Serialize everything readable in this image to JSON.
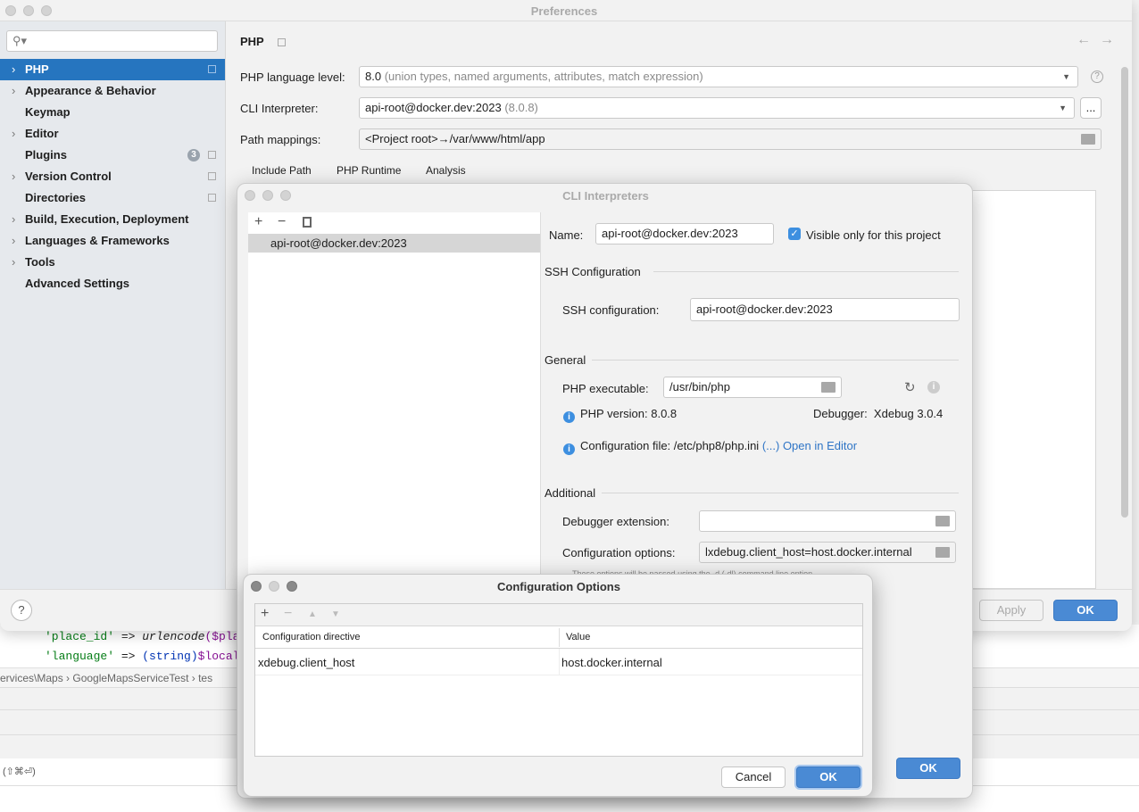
{
  "prefs": {
    "title": "Preferences",
    "search_placeholder": "",
    "sidebar": [
      {
        "label": "PHP",
        "chev": true,
        "pin": true
      },
      {
        "label": "Appearance & Behavior",
        "chev": true
      },
      {
        "label": "Keymap"
      },
      {
        "label": "Editor",
        "chev": true
      },
      {
        "label": "Plugins",
        "badge": "3",
        "pin": true
      },
      {
        "label": "Version Control",
        "chev": true,
        "pin": true
      },
      {
        "label": "Directories",
        "pin": true
      },
      {
        "label": "Build, Execution, Deployment",
        "chev": true
      },
      {
        "label": "Languages & Frameworks",
        "chev": true
      },
      {
        "label": "Tools",
        "chev": true
      },
      {
        "label": "Advanced Settings"
      }
    ],
    "page_title": "PHP",
    "lang_label": "PHP language level:",
    "lang_value": "8.0",
    "lang_hint": "(union types, named arguments, attributes, match expression)",
    "cli_label": "CLI Interpreter:",
    "cli_value": "api-root@docker.dev:2023",
    "cli_hint": "(8.0.8)",
    "more": "...",
    "path_label": "Path mappings:",
    "path_value": "<Project root>→/var/www/html/app",
    "tabs": [
      "Include Path",
      "PHP Runtime",
      "Analysis"
    ],
    "apply": "Apply",
    "ok": "OK",
    "help": "?"
  },
  "editor": {
    "line1_key": "'place_id'",
    "line1_op": " => ",
    "line1_fn": "urlencode",
    "line1_rest": "($pla",
    "line2_key": "'language'",
    "line2_op": " => ",
    "line2_cast": "(string)",
    "line2_rest": "$local",
    "breadcrumb": [
      "ervices\\Maps",
      "GoogleMapsServiceTest",
      "tes"
    ],
    "shortcut": "(⇧⌘⏎)"
  },
  "cli": {
    "title": "CLI Interpreters",
    "list": [
      "api-root@docker.dev:2023"
    ],
    "name_label": "Name:",
    "name_value": "api-root@docker.dev:2023",
    "visible_label": "Visible only for this project",
    "visible_checked": true,
    "ssh_section": "SSH Configuration",
    "ssh_label": "SSH configuration:",
    "ssh_value": "api-root@docker.dev:2023",
    "general_section": "General",
    "exe_label": "PHP executable:",
    "exe_value": "/usr/bin/php",
    "version": "PHP version: 8.0.8",
    "debugger": "Debugger:  Xdebug 3.0.4",
    "config_file": "Configuration file: /etc/php8/php.ini",
    "config_more": "(...)",
    "open_editor": "Open in Editor",
    "additional_section": "Additional",
    "dbg_ext_label": "Debugger extension:",
    "dbg_ext_value": "",
    "cfg_opts_label": "Configuration options:",
    "cfg_opts_value": "lxdebug.client_host=host.docker.internal",
    "hint": "These options will be passed using the -d (-dl) command line option",
    "ok": "OK"
  },
  "cfgdlg": {
    "title": "Configuration Options",
    "col1": "Configuration directive",
    "col2": "Value",
    "rows": [
      {
        "directive": "xdebug.client_host",
        "value": "host.docker.internal"
      }
    ],
    "cancel": "Cancel",
    "ok": "OK"
  }
}
